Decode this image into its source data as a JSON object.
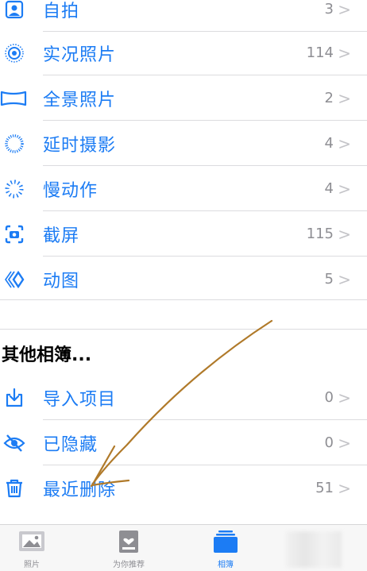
{
  "colors": {
    "accent": "#1c7cf4",
    "secondary": "#8e8e93",
    "annotation": "#b07a2a"
  },
  "media_types": [
    {
      "icon": "selfie-icon",
      "label": "自拍",
      "count": "3",
      "chevron": ">"
    },
    {
      "icon": "live-photo-icon",
      "label": "实况照片",
      "count": "114",
      "chevron": ">"
    },
    {
      "icon": "panorama-icon",
      "label": "全景照片",
      "count": "2",
      "chevron": ">"
    },
    {
      "icon": "time-lapse-icon",
      "label": "延时摄影",
      "count": "4",
      "chevron": ">"
    },
    {
      "icon": "slow-motion-icon",
      "label": "慢动作",
      "count": "4",
      "chevron": ">"
    },
    {
      "icon": "screenshot-icon",
      "label": "截屏",
      "count": "115",
      "chevron": ">"
    },
    {
      "icon": "animated-icon",
      "label": "动图",
      "count": "5",
      "chevron": ">"
    }
  ],
  "other_albums": {
    "title": "其他相簿...",
    "items": [
      {
        "icon": "import-icon",
        "label": "导入项目",
        "count": "0",
        "chevron": ">"
      },
      {
        "icon": "hidden-eye-icon",
        "label": "已隐藏",
        "count": "0",
        "chevron": ">"
      },
      {
        "icon": "trash-icon",
        "label": "最近删除",
        "count": "51",
        "chevron": ">"
      }
    ]
  },
  "tabbar": {
    "tabs": [
      {
        "icon": "photos-tab-icon",
        "label": "照片",
        "active": false
      },
      {
        "icon": "for-you-tab-icon",
        "label": "为你推荐",
        "active": false
      },
      {
        "icon": "albums-tab-icon",
        "label": "相簿",
        "active": true
      }
    ]
  }
}
